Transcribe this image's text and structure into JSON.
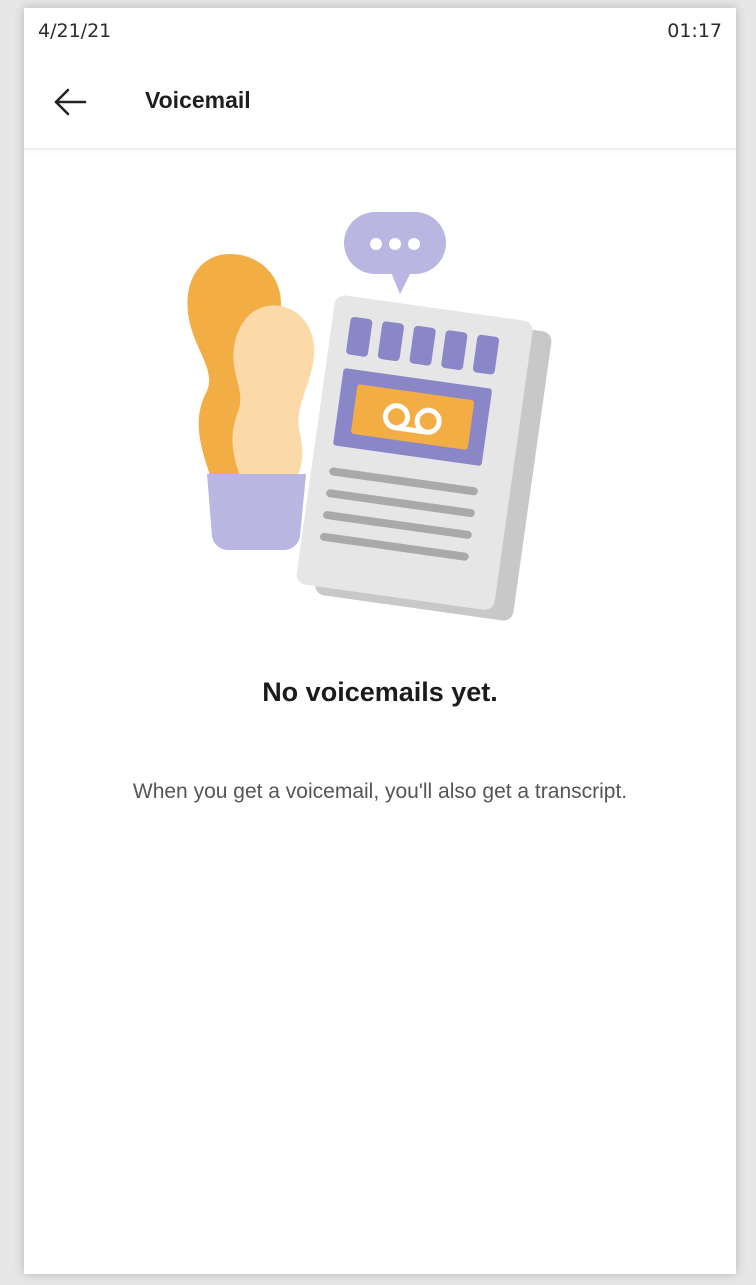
{
  "status_bar": {
    "date": "4/21/21",
    "time": "01:17"
  },
  "header": {
    "back_icon": "arrow-left-icon",
    "title": "Voicemail"
  },
  "illustration": {
    "name": "voicemail-empty-illustration"
  },
  "empty_state": {
    "title": "No voicemails yet.",
    "description": "When you get a voicemail, you'll also get a transcript."
  },
  "colors": {
    "accent": "#8a87c8",
    "lavender": "#b9b6e2",
    "orange": "#f3ad45",
    "peach": "#fbd9a8",
    "paper": "#e6e6e6",
    "paper_shadow": "#c5c5c5",
    "lines": "#a9a9a9"
  }
}
